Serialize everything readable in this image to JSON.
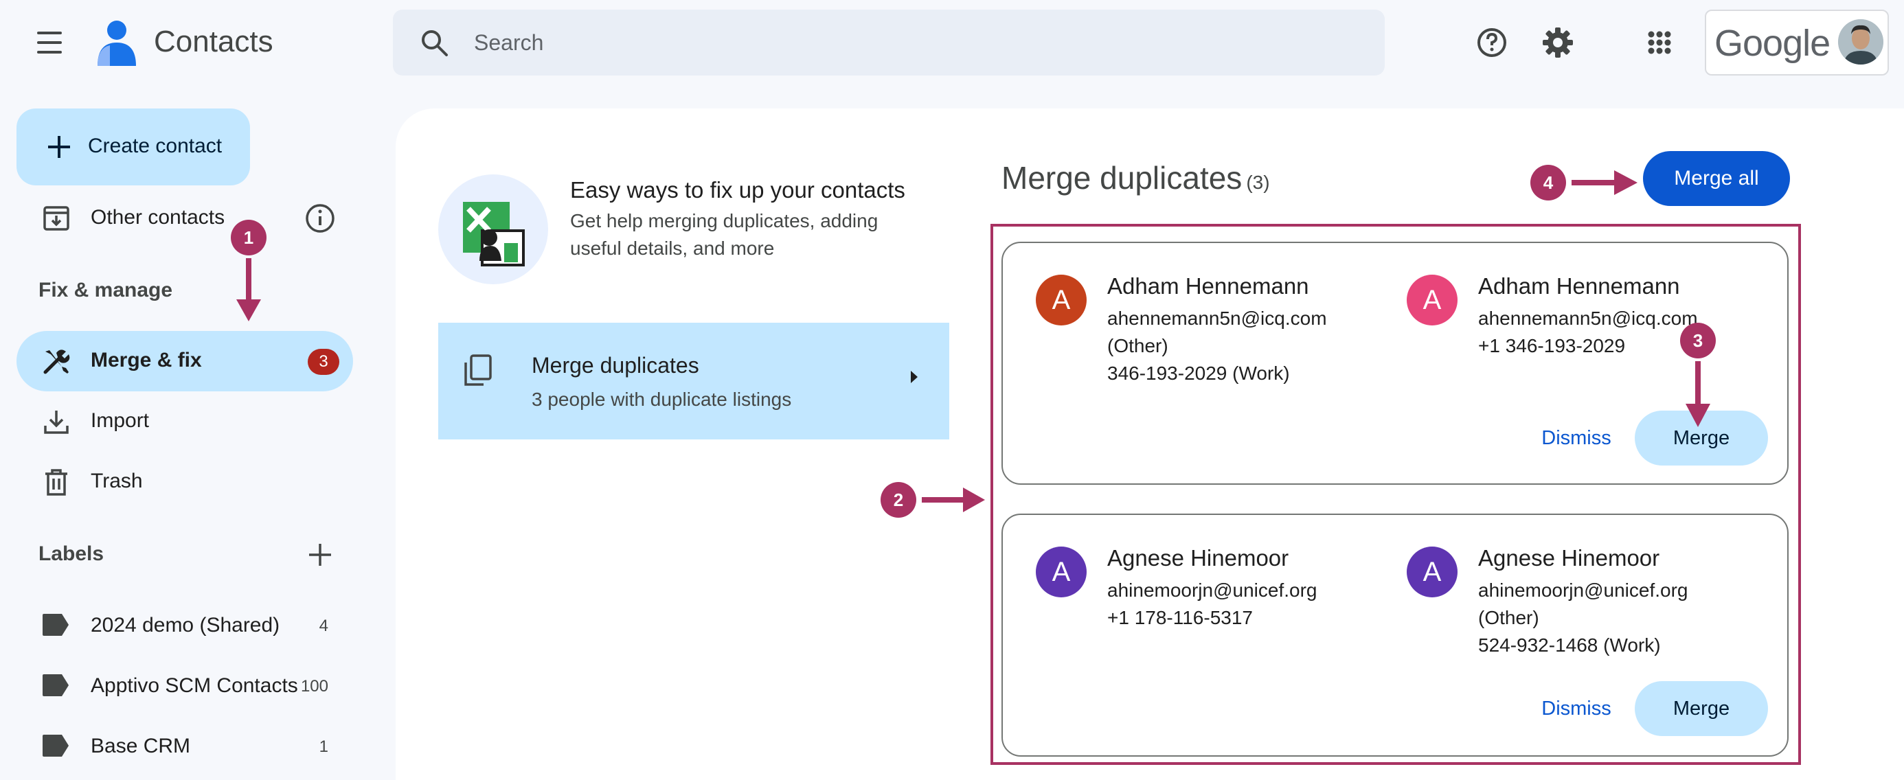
{
  "header": {
    "app_title": "Contacts",
    "search_placeholder": "Search",
    "brand_word": "Google"
  },
  "sidebar": {
    "create_label": "Create contact",
    "other_contacts_label": "Other contacts",
    "section_fix_manage": "Fix & manage",
    "items": [
      {
        "label": "Merge & fix",
        "badge": "3",
        "icon": "merge-fix-icon"
      },
      {
        "label": "Import",
        "icon": "import-icon"
      },
      {
        "label": "Trash",
        "icon": "trash-icon"
      }
    ],
    "section_labels": "Labels",
    "labels": [
      {
        "label": "2024 demo (Shared)",
        "count": "4"
      },
      {
        "label": "Apptivo SCM Contacts",
        "count": "100"
      },
      {
        "label": "Base CRM",
        "count": "1"
      }
    ]
  },
  "main": {
    "hero_title": "Easy ways to fix up your contacts",
    "hero_subtitle": "Get help merging duplicates, adding useful details, and more",
    "merge_card_title": "Merge duplicates",
    "merge_card_subtitle": "3 people with duplicate listings",
    "right_title": "Merge duplicates",
    "right_count": "(3)",
    "merge_all_label": "Merge all",
    "duplicates": [
      {
        "left": {
          "initial": "A",
          "color": "#c5411b",
          "name": "Adham Hennemann",
          "lines": [
            "ahennemann5n@icq.com",
            "(Other)",
            "346-193-2029 (Work)"
          ]
        },
        "right": {
          "initial": "A",
          "color": "#e8457a",
          "name": "Adham Hennemann",
          "lines": [
            "ahennemann5n@icq.com",
            "+1 346-193-2029"
          ]
        },
        "dismiss_label": "Dismiss",
        "merge_label": "Merge"
      },
      {
        "left": {
          "initial": "A",
          "color": "#5e35b1",
          "name": "Agnese Hinemoor",
          "lines": [
            "ahinemoorjn@unicef.org",
            "+1 178-116-5317"
          ]
        },
        "right": {
          "initial": "A",
          "color": "#5e35b1",
          "name": "Agnese Hinemoor",
          "lines": [
            "ahinemoorjn@unicef.org",
            "(Other)",
            "524-932-1468 (Work)"
          ]
        },
        "dismiss_label": "Dismiss",
        "merge_label": "Merge"
      }
    ]
  },
  "annotations": {
    "steps": [
      "1",
      "2",
      "3",
      "4"
    ],
    "color": "#a83262"
  }
}
